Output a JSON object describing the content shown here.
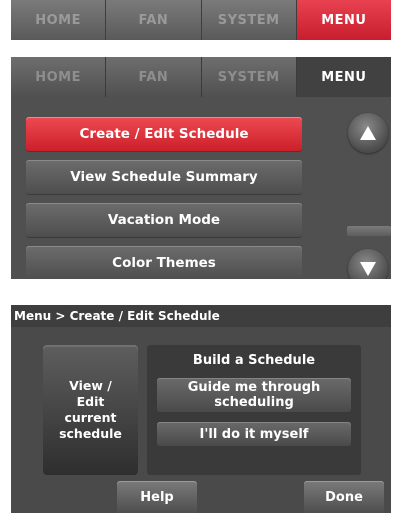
{
  "panel1": {
    "tabs": [
      "HOME",
      "FAN",
      "SYSTEM",
      "MENU"
    ],
    "active_tab": "MENU",
    "active_color": "#d92534"
  },
  "panel2": {
    "tabs": [
      "HOME",
      "FAN",
      "SYSTEM",
      "MENU"
    ],
    "active_tab": "MENU",
    "menu_items": [
      "Create / Edit Schedule",
      "View Schedule Summary",
      "Vacation Mode",
      "Color Themes"
    ],
    "selected_item": "Create / Edit Schedule",
    "scroll_up_icon": "up-triangle-icon",
    "scroll_down_icon": "down-triangle-icon"
  },
  "panel3": {
    "breadcrumb": "Menu > Create / Edit Schedule",
    "view_edit_label": "View / Edit current schedule",
    "build_title": "Build a Schedule",
    "guide_label": "Guide me through scheduling",
    "self_label": "I'll do it myself",
    "help_label": "Help",
    "done_label": "Done"
  }
}
